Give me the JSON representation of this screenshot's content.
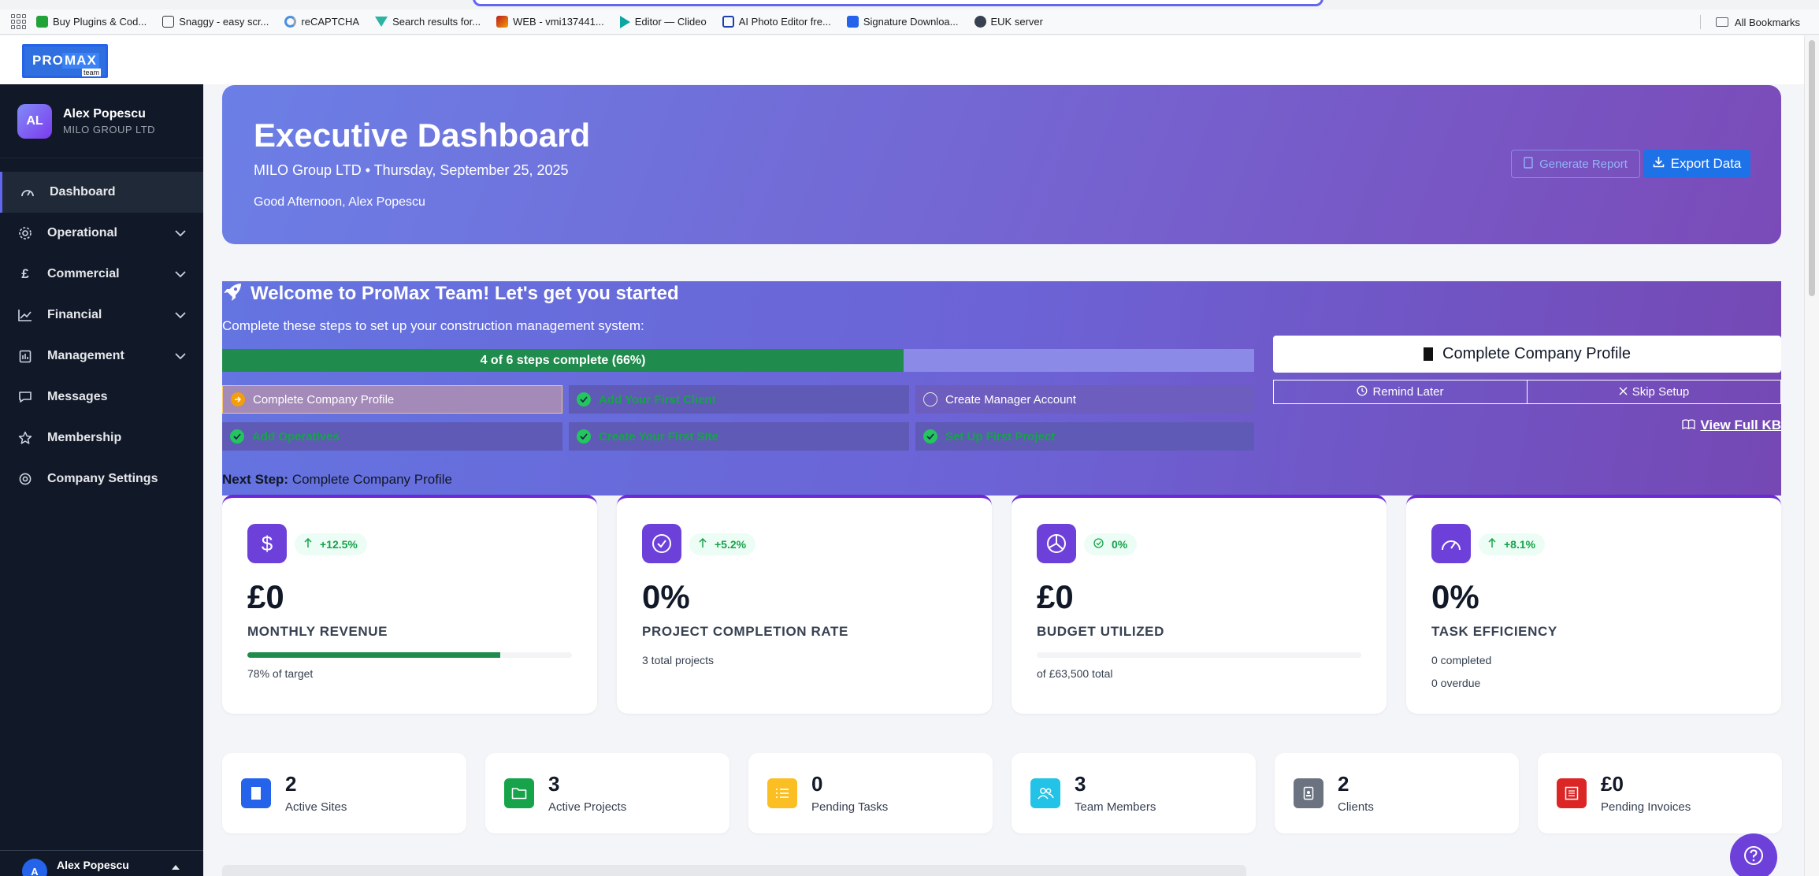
{
  "bookmarks": {
    "items": [
      {
        "label": "Buy Plugins & Cod...",
        "icon": "leaf-icon",
        "color": "#22a33a"
      },
      {
        "label": "Snaggy - easy scr...",
        "icon": "snaggy-icon",
        "color": "#333333"
      },
      {
        "label": "reCAPTCHA",
        "icon": "recaptcha-icon",
        "color": "#4a90e2"
      },
      {
        "label": "Search results for...",
        "icon": "vue-icon",
        "color": "#2bb3a3"
      },
      {
        "label": "WEB - vmi137441...",
        "icon": "k-icon",
        "color": "#b91c1c"
      },
      {
        "label": "Editor — Clideo",
        "icon": "play-icon",
        "color": "#0ea5a3"
      },
      {
        "label": "AI Photo Editor fre...",
        "icon": "photo-icon",
        "color": "#1e40af"
      },
      {
        "label": "Signature Downloa...",
        "icon": "signature-icon",
        "color": "#2563eb"
      },
      {
        "label": "EUK server",
        "icon": "globe-icon",
        "color": "#374151"
      }
    ],
    "all_bookmarks": "All Bookmarks"
  },
  "logo": {
    "pro": "PRO",
    "max": "MAX",
    "team": "team"
  },
  "sidebar": {
    "user": {
      "initials": "AL",
      "name": "Alex Popescu",
      "company": "MILO GROUP LTD"
    },
    "items": [
      {
        "label": "Dashboard",
        "icon": "dashboard-gauge-icon",
        "active": true,
        "expandable": false
      },
      {
        "label": "Operational",
        "icon": "gear-icon",
        "active": false,
        "expandable": true
      },
      {
        "label": "Commercial",
        "icon": "pound-icon",
        "active": false,
        "expandable": true
      },
      {
        "label": "Financial",
        "icon": "chart-line-icon",
        "active": false,
        "expandable": true
      },
      {
        "label": "Management",
        "icon": "clipboard-icon",
        "active": false,
        "expandable": true
      },
      {
        "label": "Messages",
        "icon": "message-icon",
        "active": false,
        "expandable": false
      },
      {
        "label": "Membership",
        "icon": "star-icon",
        "active": false,
        "expandable": false
      },
      {
        "label": "Company Settings",
        "icon": "settings-icon",
        "active": false,
        "expandable": false
      }
    ],
    "footer": {
      "initial": "A",
      "name": "Alex Popescu"
    }
  },
  "hero": {
    "title": "Executive Dashboard",
    "subtitle": "MILO Group LTD • Thursday, September 25, 2025",
    "greeting": "Good Afternoon, Alex Popescu",
    "generate_label": "Generate Report",
    "export_label": "Export Data"
  },
  "onboarding": {
    "title": "Welcome to ProMax Team! Let's get you started",
    "description": "Complete these steps to set up your construction management system:",
    "progress_text": "4 of 6 steps complete (66%)",
    "progress_fraction": 0.66,
    "steps": [
      {
        "label": "Complete Company Profile",
        "status": "current"
      },
      {
        "label": "Add Your First Client",
        "status": "done"
      },
      {
        "label": "Create Manager Account",
        "status": "todo"
      },
      {
        "label": "Add Operatives",
        "status": "done"
      },
      {
        "label": "Create Your First Site",
        "status": "done"
      },
      {
        "label": "Set Up First Project",
        "status": "done"
      }
    ],
    "primary_button": "Complete Company Profile",
    "remind_label": "Remind Later",
    "skip_label": "Skip Setup",
    "kb_label": "View Full KB",
    "next_step_label": "Next Step:",
    "next_step_value": "Complete Company Profile"
  },
  "kpis": [
    {
      "icon": "dollar-icon",
      "trend": "+12.5%",
      "trend_icon": "arrow-up-icon",
      "value": "£0",
      "label": "MONTHLY REVENUE",
      "progress_fraction": 0.78,
      "sub": [
        "78% of target"
      ]
    },
    {
      "icon": "check-circle-icon",
      "trend": "+5.2%",
      "trend_icon": "arrow-up-icon",
      "value": "0%",
      "label": "PROJECT COMPLETION RATE",
      "sub": [
        "3 total projects"
      ]
    },
    {
      "icon": "pie-chart-icon",
      "trend": "0%",
      "trend_icon": "check-circle-small-icon",
      "value": "£0",
      "label": "BUDGET UTILIZED",
      "progress_fraction": 0.0,
      "sub": [
        "of £63,500 total"
      ]
    },
    {
      "icon": "speedometer-icon",
      "trend": "+8.1%",
      "trend_icon": "arrow-up-icon",
      "value": "0%",
      "label": "TASK EFFICIENCY",
      "sub": [
        "0 completed",
        "0 overdue"
      ]
    }
  ],
  "stats": [
    {
      "value": "2",
      "label": "Active Sites",
      "icon": "building-icon",
      "color": "#2563eb"
    },
    {
      "value": "3",
      "label": "Active Projects",
      "icon": "folder-icon",
      "color": "#16a34a"
    },
    {
      "value": "0",
      "label": "Pending Tasks",
      "icon": "list-icon",
      "color": "#fbbf24"
    },
    {
      "value": "3",
      "label": "Team Members",
      "icon": "users-icon",
      "color": "#22c3e6"
    },
    {
      "value": "2",
      "label": "Clients",
      "icon": "id-badge-icon",
      "color": "#6b7280"
    },
    {
      "value": "£0",
      "label": "Pending Invoices",
      "icon": "invoice-icon",
      "color": "#dc2626"
    }
  ],
  "help": {
    "icon": "question-icon"
  }
}
